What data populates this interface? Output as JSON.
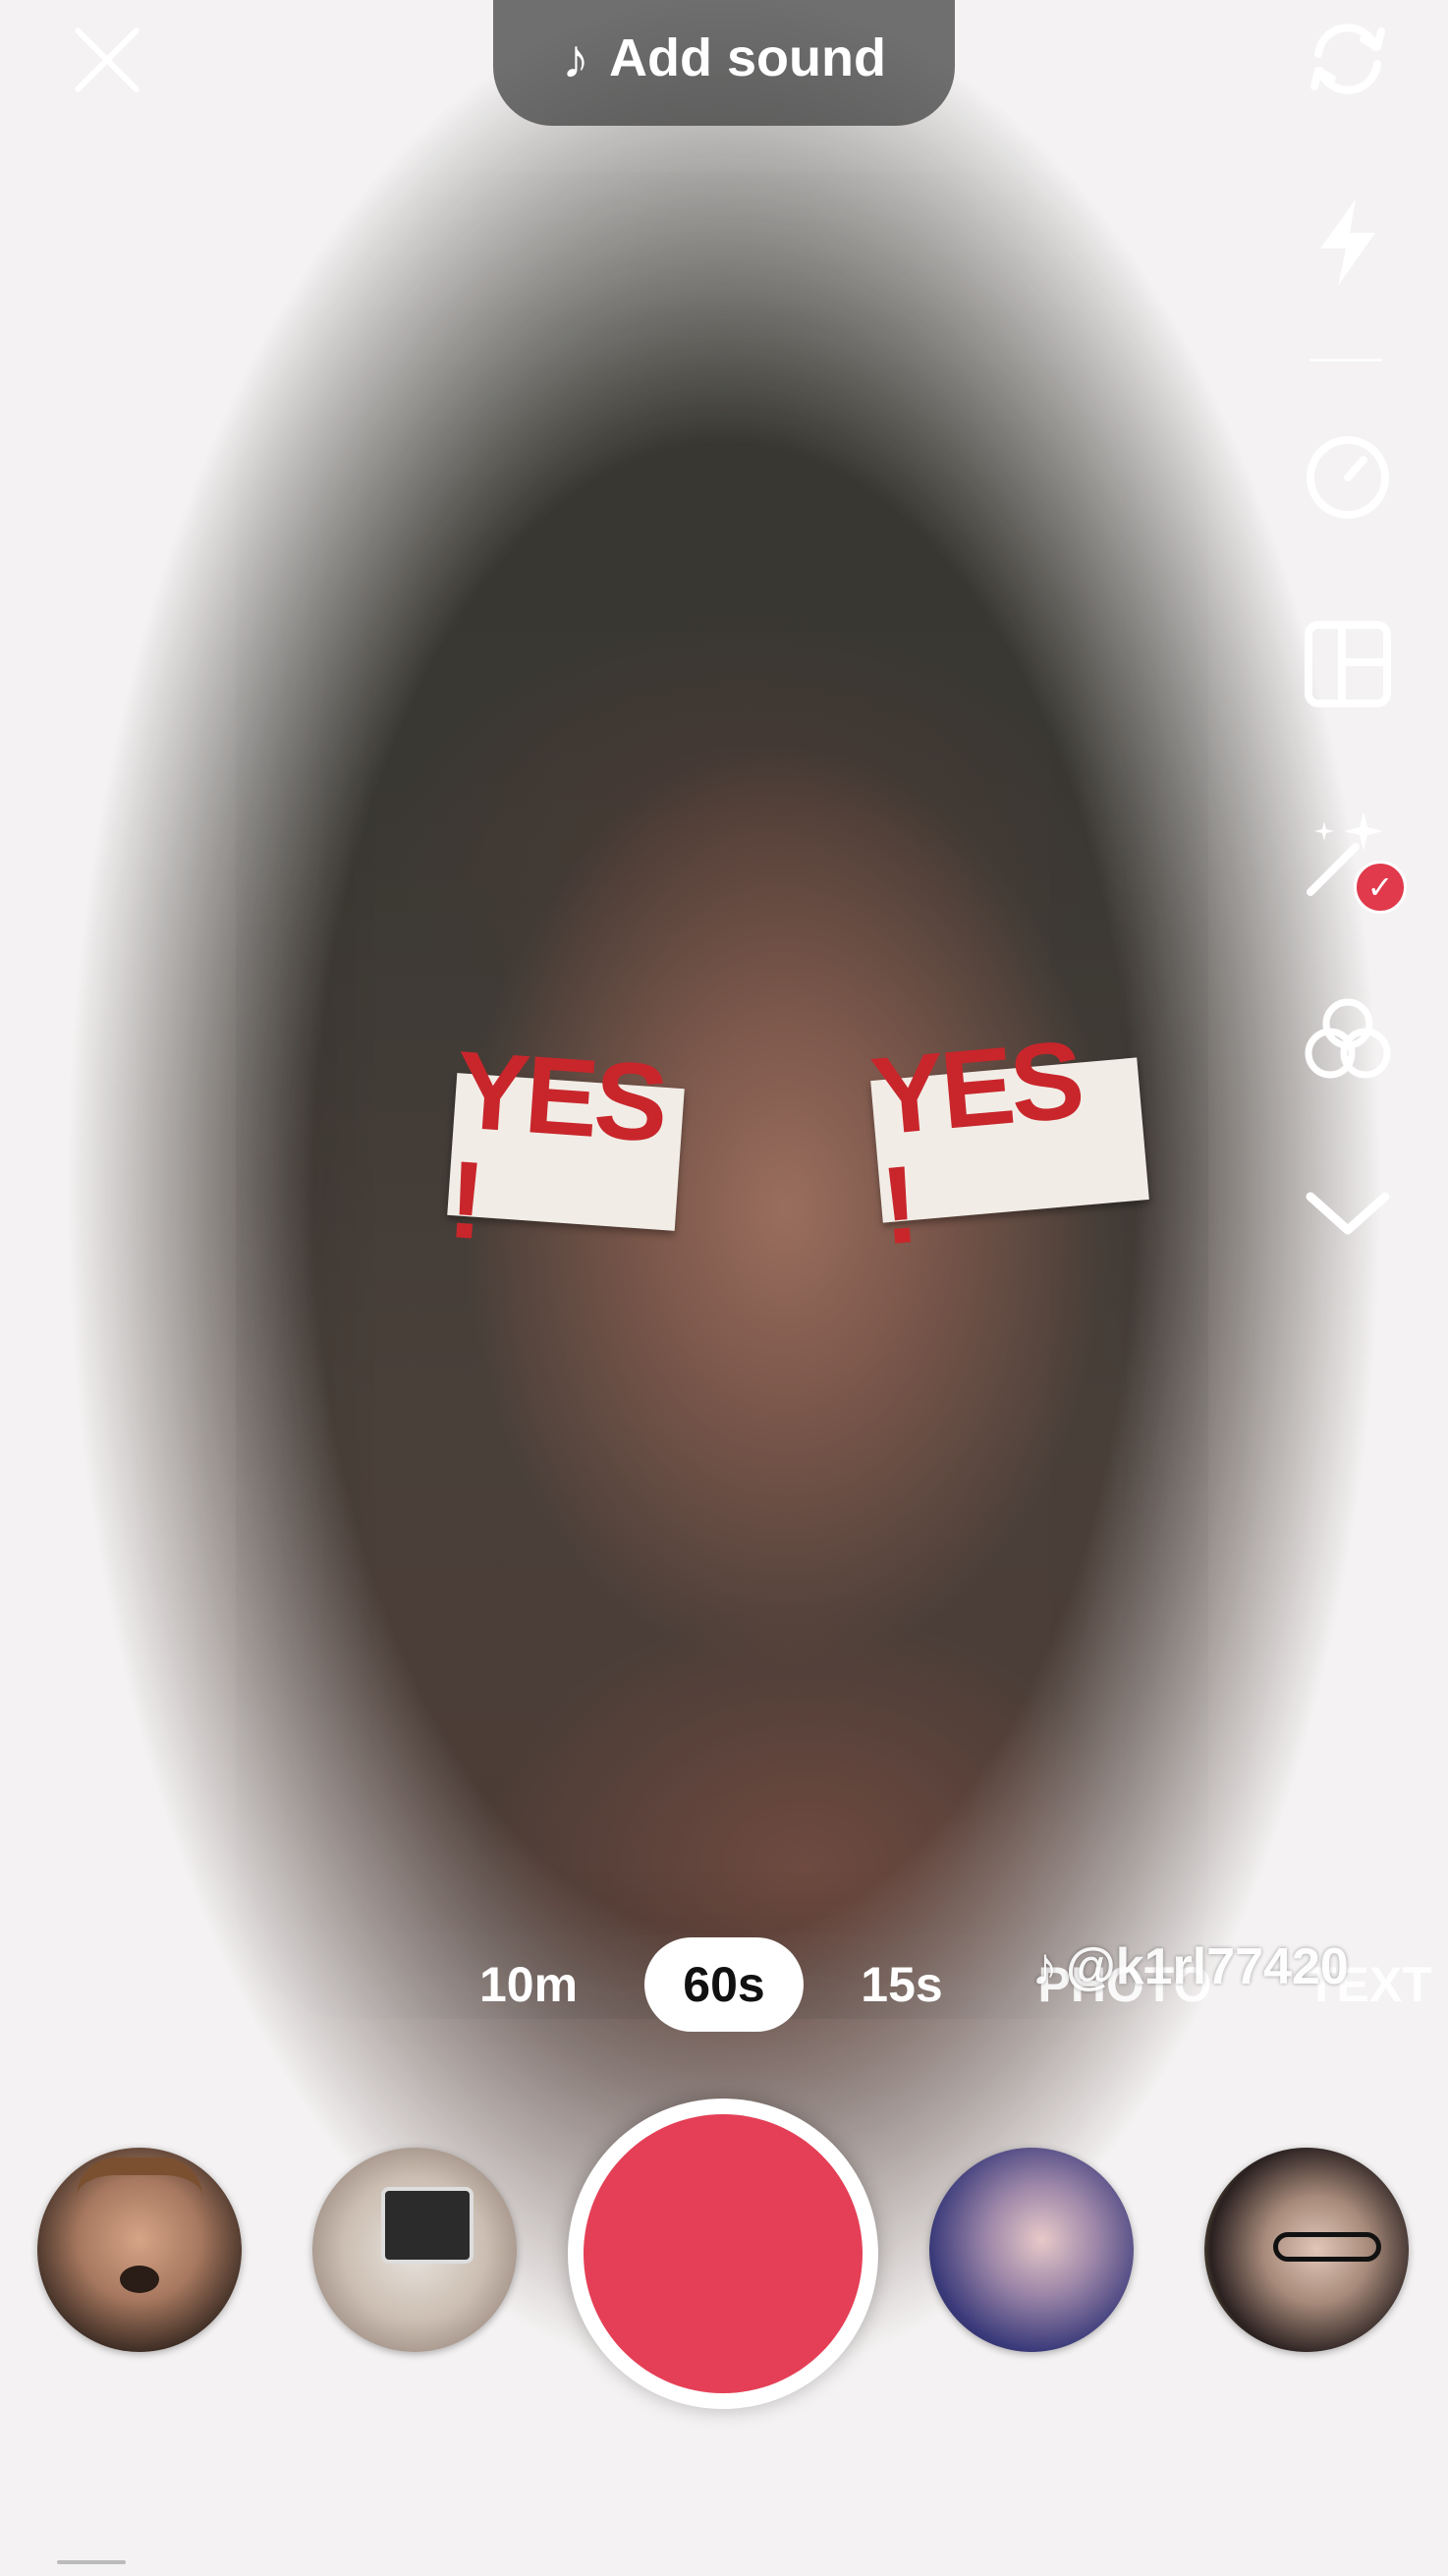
{
  "header": {
    "add_sound_label": "Add sound",
    "note_icon": "♪"
  },
  "camera": {
    "sticker_left": "YES !",
    "sticker_right": "YES !"
  },
  "toolbar": {
    "icons": [
      "flip-camera-icon",
      "flash-icon",
      "timer-icon",
      "layout-icon",
      "beautify-icon",
      "filters-icon",
      "chevron-down-icon"
    ],
    "beautify_badge": "✓"
  },
  "durations": {
    "items": [
      "10m",
      "60s",
      "15s",
      "PHOTO",
      "TEXT"
    ],
    "selected": "60s"
  },
  "watermark": {
    "logo": "♪",
    "handle": "@k1rl77420"
  },
  "colors": {
    "record": "#e43f56",
    "badge": "#e03a4c"
  }
}
